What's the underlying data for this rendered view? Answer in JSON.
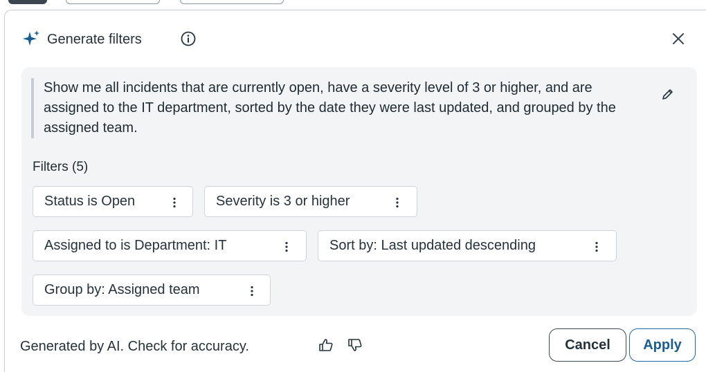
{
  "dialog": {
    "title": "Generate filters",
    "icons": {
      "sparkle": "sparkle-icon",
      "info": "info-icon",
      "close": "close-icon",
      "edit": "pencil-icon"
    },
    "prompt": "Show me all incidents that are currently open, have a severity level of 3 or higher, and are assigned to the IT department, sorted by the date they were last updated, and grouped by the assigned team.",
    "filters_heading": "Filters (5)",
    "filters": [
      {
        "label": "Status is Open"
      },
      {
        "label": "Severity is 3 or higher"
      },
      {
        "label": "Assigned to is Department: IT"
      },
      {
        "label": "Sort by: Last updated descending"
      },
      {
        "label": "Group by: Assigned team"
      }
    ],
    "footer": {
      "disclaimer": "Generated by AI. Check for accuracy.",
      "cancel_label": "Cancel",
      "apply_label": "Apply"
    }
  },
  "colors": {
    "accent": "#1a5d95",
    "sparkle": "#1a5d95",
    "panel_bg": "#f2f4f5",
    "text": "#1f2a33"
  }
}
